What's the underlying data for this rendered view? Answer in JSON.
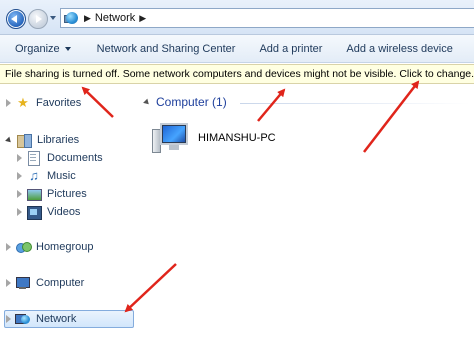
{
  "address": {
    "crumbs": [
      "Network"
    ]
  },
  "toolbar": {
    "organize": "Organize",
    "network_sharing": "Network and Sharing Center",
    "add_printer": "Add a printer",
    "add_wireless": "Add a wireless device"
  },
  "infobar": {
    "message": "File sharing is turned off. Some network computers and devices might not be visible. Click to change..."
  },
  "nav": {
    "favorites": "Favorites",
    "libraries": "Libraries",
    "documents": "Documents",
    "music": "Music",
    "pictures": "Pictures",
    "videos": "Videos",
    "homegroup": "Homegroup",
    "computer": "Computer",
    "network": "Network"
  },
  "content": {
    "group_header": "Computer (1)",
    "items": [
      {
        "label": "HIMANSHU-PC",
        "icon": "computer-icon"
      }
    ]
  },
  "colors": {
    "annotation_arrow": "#e0251b",
    "link_text": "#1e395b",
    "group_header": "#1e3f9c",
    "infobar_bg": "#ffffe1"
  }
}
